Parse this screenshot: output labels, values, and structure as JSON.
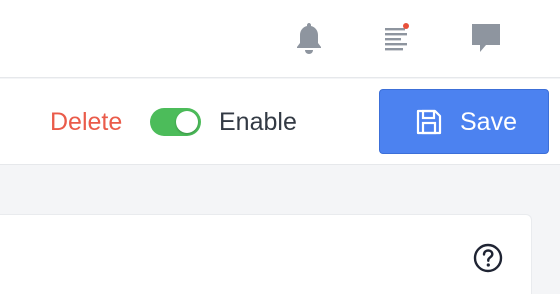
{
  "topbar": {
    "icons": [
      {
        "name": "bell-icon",
        "has_badge": false
      },
      {
        "name": "list-icon",
        "has_badge": true
      },
      {
        "name": "chat-icon",
        "has_badge": false
      }
    ]
  },
  "actionbar": {
    "delete_label": "Delete",
    "toggle": {
      "label": "Enable",
      "on": true
    },
    "save_label": "Save"
  },
  "panel": {
    "help_icon": "question-icon"
  },
  "colors": {
    "delete": "#ea5b4a",
    "toggle_on": "#4cbc5a",
    "primary": "#4c82f0",
    "icon_gray": "#8e959f",
    "badge": "#e8503a"
  }
}
